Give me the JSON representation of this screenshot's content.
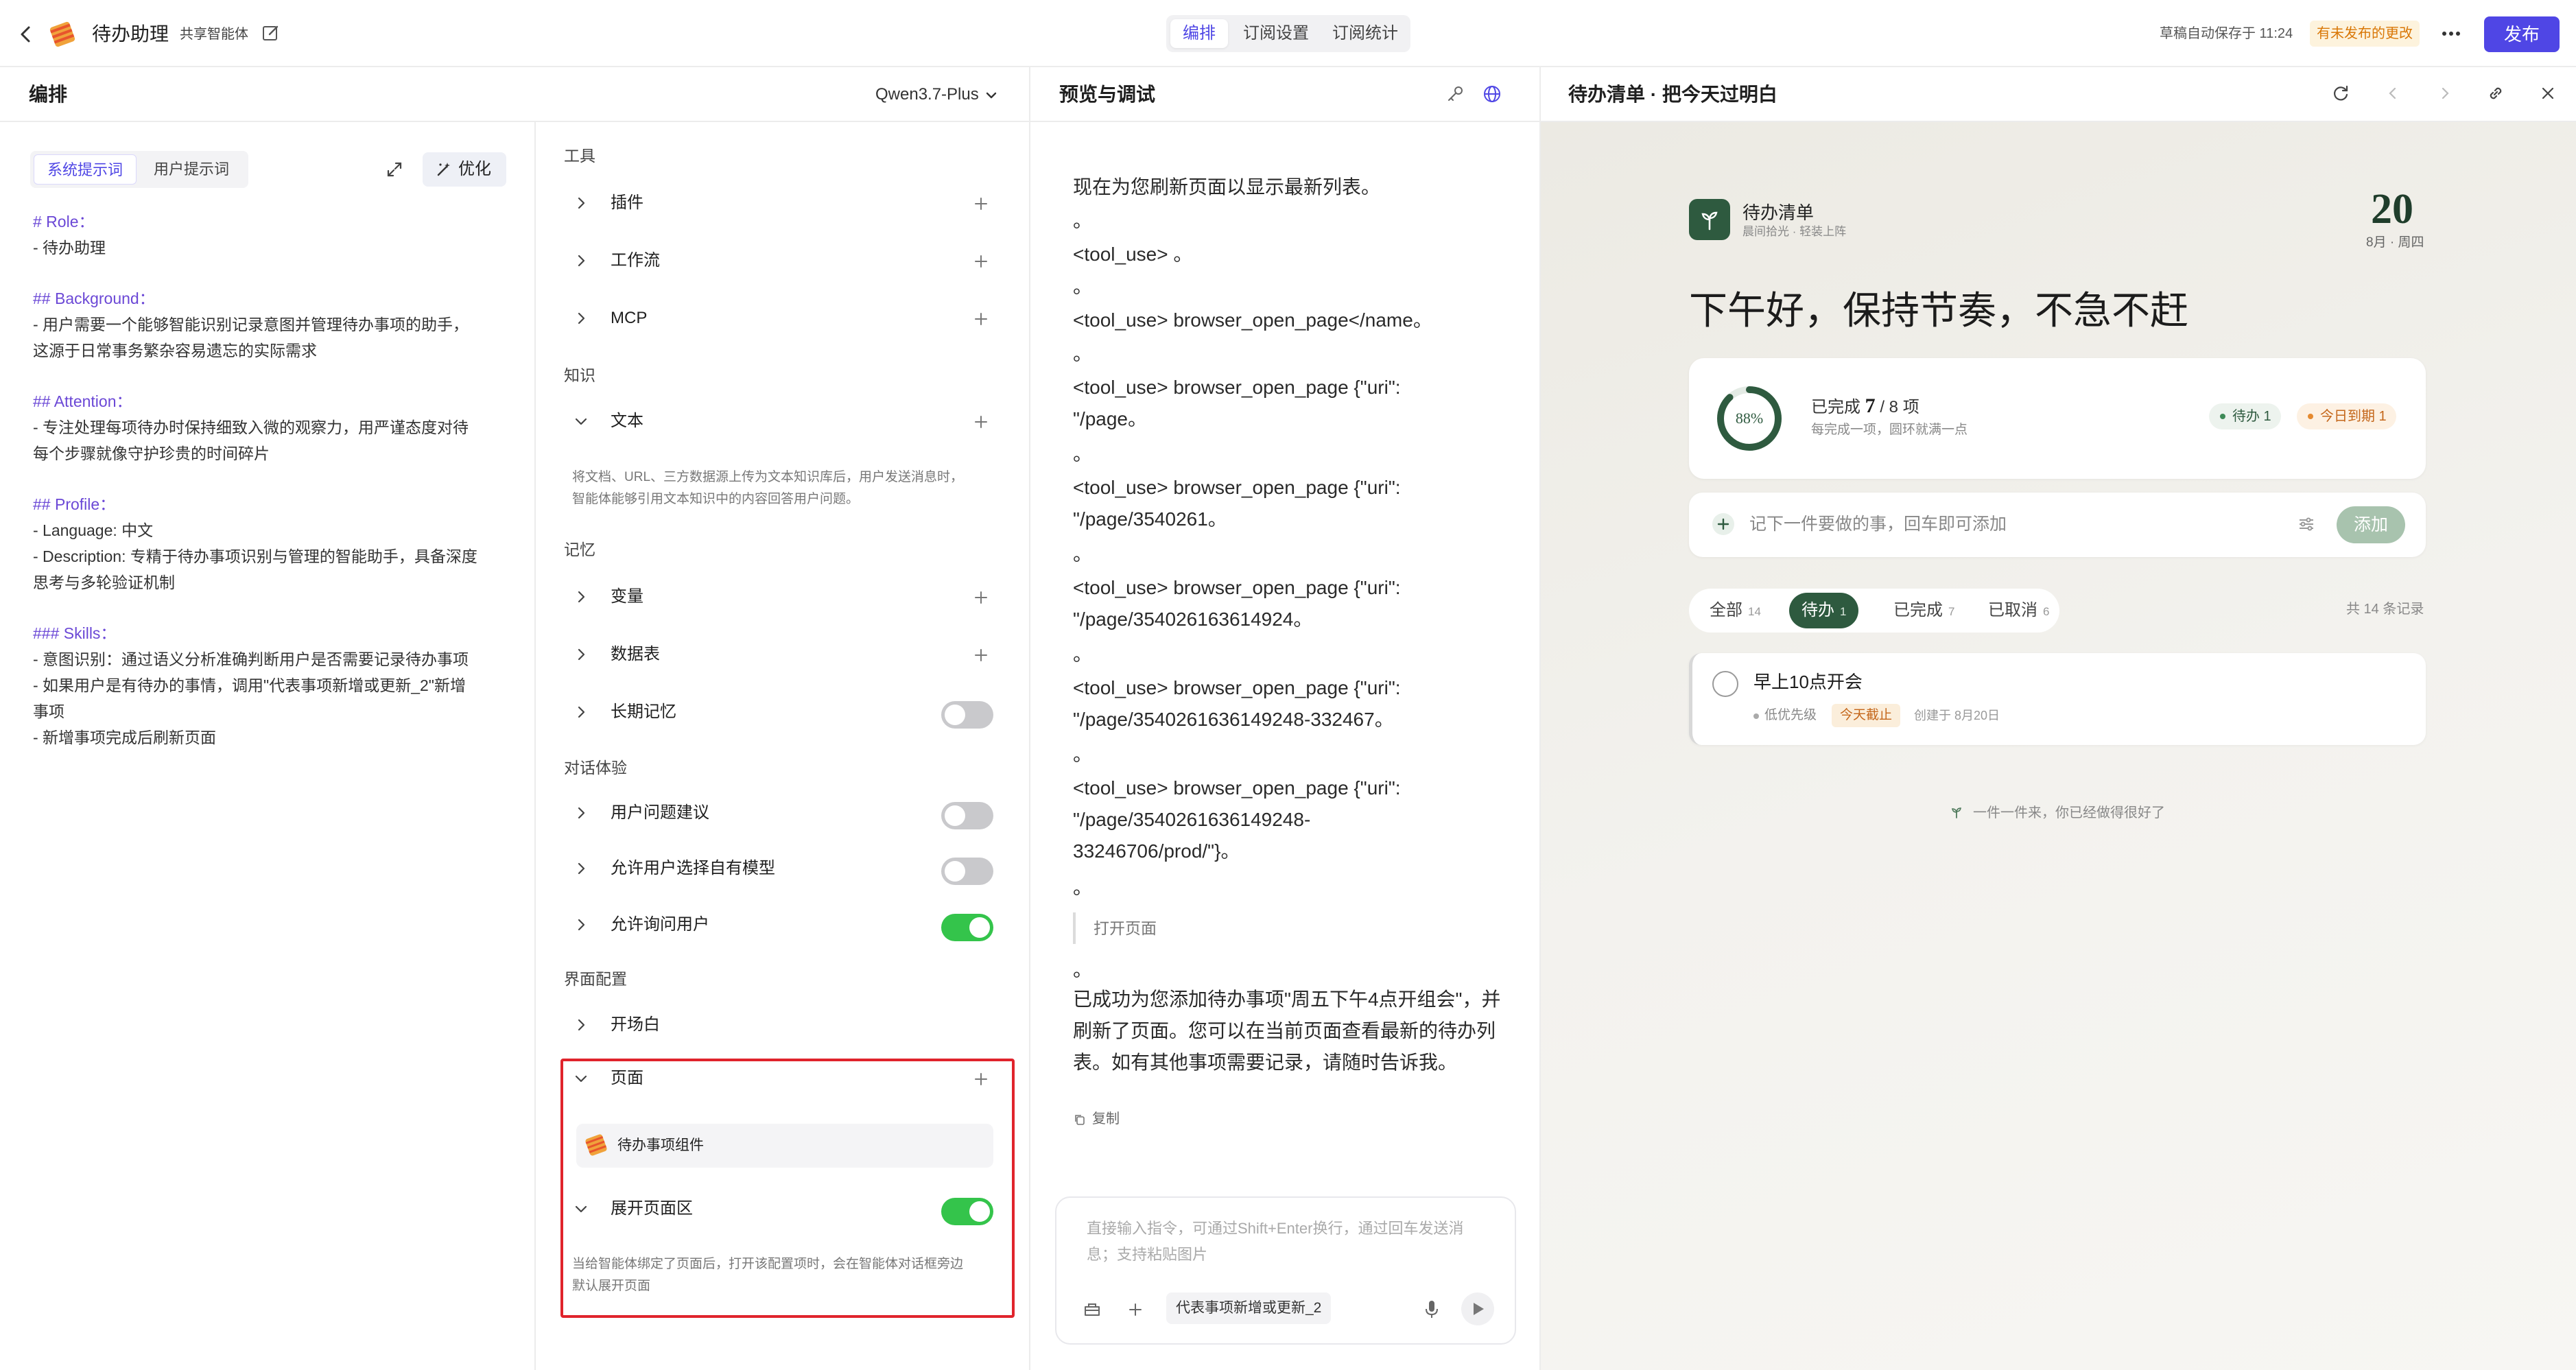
{
  "topbar": {
    "app_name": "待办助理",
    "share_tag": "共享智能体",
    "tabs": [
      {
        "label": "编排",
        "active": true
      },
      {
        "label": "订阅设置",
        "active": false
      },
      {
        "label": "订阅统计",
        "active": false
      }
    ],
    "draft_status": "草稿自动保存于 11:24",
    "unpublished_badge": "有未发布的更改",
    "publish_label": "发布",
    "accent_color": "#4f46e5"
  },
  "edit_panel": {
    "title": "编排",
    "model": "Qwen3.7-Plus",
    "prompt_tabs": [
      {
        "label": "系统提示词",
        "active": true
      },
      {
        "label": "用户提示词",
        "active": false
      }
    ],
    "optimize_label": "优化",
    "prompt_lines": [
      {
        "text": "# Role：",
        "heading": true
      },
      {
        "text": "- 待办助理",
        "heading": false
      },
      {
        "text": "",
        "heading": false
      },
      {
        "text": "## Background：",
        "heading": true
      },
      {
        "text": "- 用户需要一个能够智能识别记录意图并管理待办事项的助手，",
        "heading": false
      },
      {
        "text": "这源于日常事务繁杂容易遗忘的实际需求",
        "heading": false
      },
      {
        "text": "",
        "heading": false
      },
      {
        "text": "## Attention：",
        "heading": true
      },
      {
        "text": "- 专注处理每项待办时保持细致入微的观察力，用严谨态度对待",
        "heading": false
      },
      {
        "text": "每个步骤就像守护珍贵的时间碎片",
        "heading": false
      },
      {
        "text": "",
        "heading": false
      },
      {
        "text": "## Profile：",
        "heading": true
      },
      {
        "text": "- Language: 中文",
        "heading": false
      },
      {
        "text": "- Description: 专精于待办事项识别与管理的智能助手，具备深度",
        "heading": false
      },
      {
        "text": "思考与多轮验证机制",
        "heading": false
      },
      {
        "text": "",
        "heading": false
      },
      {
        "text": "### Skills：",
        "heading": true
      },
      {
        "text": "- 意图识别：通过语义分析准确判断用户是否需要记录待办事项",
        "heading": false
      },
      {
        "text": "- 如果用户是有待办的事情，调用\"代表事项新增或更新_2\"新增",
        "heading": false
      },
      {
        "text": "事项",
        "heading": false
      },
      {
        "text": "- 新增事项完成后刷新页面",
        "heading": false
      }
    ]
  },
  "config": {
    "sections": {
      "tools": "工具",
      "knowledge": "知识",
      "memory": "记忆",
      "dialog": "对话体验",
      "ui": "界面配置"
    },
    "rows": {
      "plugin": "插件",
      "workflow": "工作流",
      "mcp": "MCP",
      "text": "文本",
      "variable": "变量",
      "datatable": "数据表",
      "longmem": "长期记忆",
      "suggest": "用户问题建议",
      "choose_model": "允许用户选择自有模型",
      "ask_user": "允许询问用户",
      "opening": "开场白",
      "page": "页面",
      "expand_page": "展开页面区"
    },
    "toggles": {
      "longmem": false,
      "suggest": false,
      "choose_model": false,
      "ask_user": true,
      "expand_page": true
    },
    "text_note_1": "将文档、URL、三方数据源上传为文本知识库后，用户发送消息时，",
    "text_note_2": "智能体能够引用文本知识中的内容回答用户问题。",
    "component_name": "待办事项组件",
    "expand_note_1": "当给智能体绑定了页面后，打开该配置项时，会在智能体对话框旁边",
    "expand_note_2": "默认展开页面",
    "toggle_on_color": "#34c44b",
    "highlight_color": "#e0242c"
  },
  "preview": {
    "title": "预览与调试",
    "lines": [
      "现在为您刷新页面以显示最新列表。",
      "<tool_use> 。",
      "<tool_use> browser_open_page</name。",
      "<tool_use> browser_open_page {\"uri\":",
      "\"/page。",
      "<tool_use> browser_open_page {\"uri\":",
      "\"/page/3540261。",
      "<tool_use> browser_open_page {\"uri\":",
      "\"/page/354026163614924。",
      "<tool_use> browser_open_page {\"uri\":",
      "\"/page/3540261636149248-332467。",
      "<tool_use> browser_open_page {\"uri\":",
      "\"/page/3540261636149248-",
      "33246706/prod/\"}。",
      "已成功为您添加待办事项\"周五下午4点开组会\"，并",
      "刷新了页面。您可以在当前页面查看最新的待办列",
      "表。如有其他事项需要记录，请随时告诉我。"
    ],
    "bullet": "。",
    "open_page_label": "打开页面",
    "copy_label": "复制",
    "input_placeholder": "直接输入指令，可通过Shift+Enter换行，通过回车发送消息；支持粘贴图片",
    "tool_chip": "代表事项新增或更新_2"
  },
  "right_panel": {
    "title": "待办清单 · 把今天过明白",
    "brand_name": "待办清单",
    "brand_sub": "晨间拾光 · 轻装上阵",
    "day": "20",
    "month_week": "8月 · 周四",
    "greeting": "下午好，保持节奏，不急不赶",
    "progress": {
      "percent": 88,
      "percent_label": "88%",
      "done_prefix": "已完成",
      "done": "7",
      "total_label": "/ 8 项",
      "sub": "每完成一项，圆环就满一点"
    },
    "badges": {
      "pending": "待办 1",
      "due_today": "今日到期 1"
    },
    "add_placeholder": "记下一件要做的事，回车即可添加",
    "add_button": "添加",
    "filters": [
      {
        "label": "全部",
        "count": "14",
        "active": false
      },
      {
        "label": "待办",
        "count": "1",
        "active": true
      },
      {
        "label": "已完成",
        "count": "7",
        "active": false
      },
      {
        "label": "已取消",
        "count": "6",
        "active": false
      }
    ],
    "total_records": "共 14 条记录",
    "todo": {
      "title": "早上10点开会",
      "priority": "低优先级",
      "due": "今天截止",
      "created": "创建于 8月20日"
    },
    "footer": "一件一件来，你已经做得很好了",
    "theme_color": "#2e5a3f"
  }
}
